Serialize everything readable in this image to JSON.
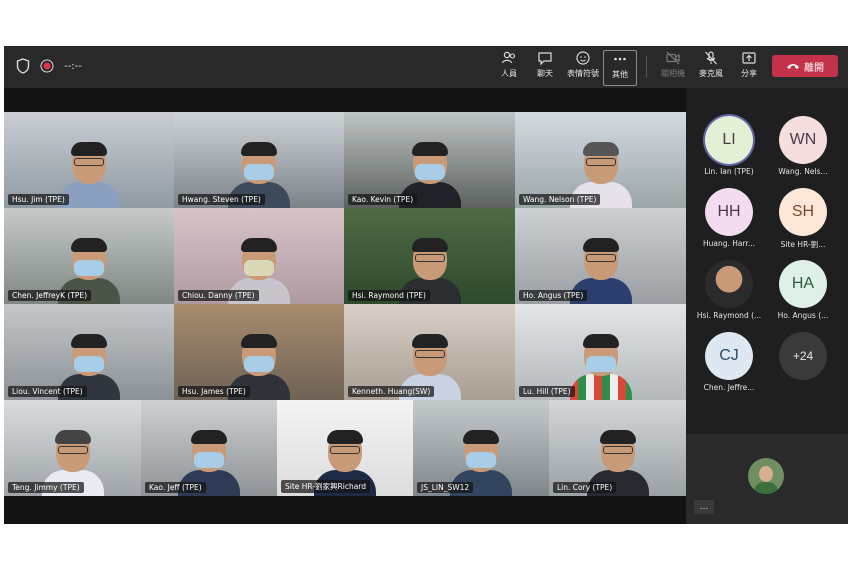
{
  "toolbar": {
    "timer": "--:--",
    "buttons": [
      {
        "label": "人員"
      },
      {
        "label": "聊天"
      },
      {
        "label": "表情符號"
      },
      {
        "label": "其他"
      },
      {
        "label": "關相機"
      },
      {
        "label": "麥克風"
      },
      {
        "label": "分享"
      }
    ],
    "leave_label": "離開"
  },
  "tiles": [
    {
      "name": "Hsu. Jim (TPE)"
    },
    {
      "name": "Hwang. Steven (TPE)"
    },
    {
      "name": "Kao. Kevin (TPE)"
    },
    {
      "name": "Wang. Nelson (TPE)"
    },
    {
      "name": "Chen. JeffreyK (TPE)"
    },
    {
      "name": "Chiou. Danny (TPE)"
    },
    {
      "name": "Hsi. Raymond (TPE)"
    },
    {
      "name": "Ho. Angus (TPE)"
    },
    {
      "name": "Liou. Vincent (TPE)"
    },
    {
      "name": "Hsu. James (TPE)"
    },
    {
      "name": "Kenneth. Huang(SW)"
    },
    {
      "name": "Lu. Hill (TPE)"
    },
    {
      "name": "Teng. Jimmy (TPE)"
    },
    {
      "name": "Kao. Jeff (TPE)"
    },
    {
      "name": "Site HR-劉家興Richard"
    },
    {
      "name": "JS_LIN_SW12"
    },
    {
      "name": "Lin. Cory (TPE)"
    }
  ],
  "roster": [
    {
      "initials": "LI",
      "name": "Lin. Ian (TPE)"
    },
    {
      "initials": "WN",
      "name": "Wang. Nels..."
    },
    {
      "initials": "HH",
      "name": "Huang. Harr..."
    },
    {
      "initials": "SH",
      "name": "Site HR-劉..."
    },
    {
      "initials": "",
      "name": "Hsi. Raymond (..."
    },
    {
      "initials": "HA",
      "name": "Ho. Angus (..."
    },
    {
      "initials": "CJ",
      "name": "Chen. Jeffre..."
    },
    {
      "initials": "+24",
      "name": ""
    }
  ],
  "more_label": "...",
  "colors": {
    "leave": "#c4314b",
    "active_ring": "#6264a7"
  }
}
